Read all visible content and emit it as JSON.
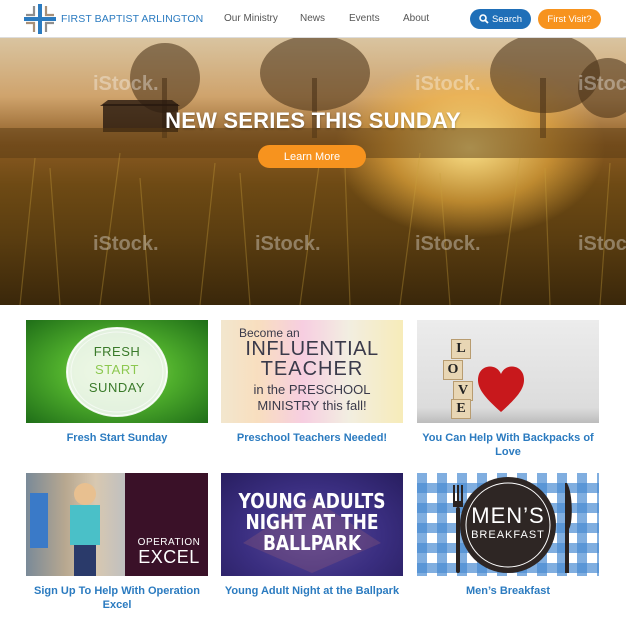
{
  "header": {
    "brand": "FIRST BAPTIST ARLINGTON",
    "nav": [
      "Our Ministry",
      "News",
      "Events",
      "About"
    ],
    "search_label": "Search",
    "first_visit_label": "First Visit?",
    "colors": {
      "primary": "#1f6fb8",
      "accent": "#f7931e",
      "link": "#2b7bc0"
    }
  },
  "hero": {
    "title": "NEW SERIES THIS SUNDAY",
    "button_label": "Learn More",
    "watermark": "iStock."
  },
  "cards": [
    {
      "caption": "Fresh Start Sunday",
      "image_lines": [
        "FRESH",
        "START",
        "SUNDAY"
      ]
    },
    {
      "caption": "Preschool Teachers Needed!",
      "image_lines": [
        "Become an",
        "INFLUENTIAL",
        "TEACHER",
        "in the PRESCHOOL",
        "MINISTRY this fall!"
      ]
    },
    {
      "caption": "You Can Help With Backpacks of Love",
      "image_lines": [
        "L",
        "O",
        "V",
        "E"
      ]
    },
    {
      "caption": "Sign Up To Help With Operation Excel",
      "image_lines": [
        "OPERATION",
        "EXCEL"
      ]
    },
    {
      "caption": "Young Adult Night at the Ballpark",
      "image_lines": [
        "YOUNG ADULTS",
        "NIGHT AT THE",
        "BALLPARK"
      ]
    },
    {
      "caption": "Men’s Breakfast",
      "image_lines": [
        "MEN’S",
        "BREAKFAST"
      ]
    }
  ]
}
